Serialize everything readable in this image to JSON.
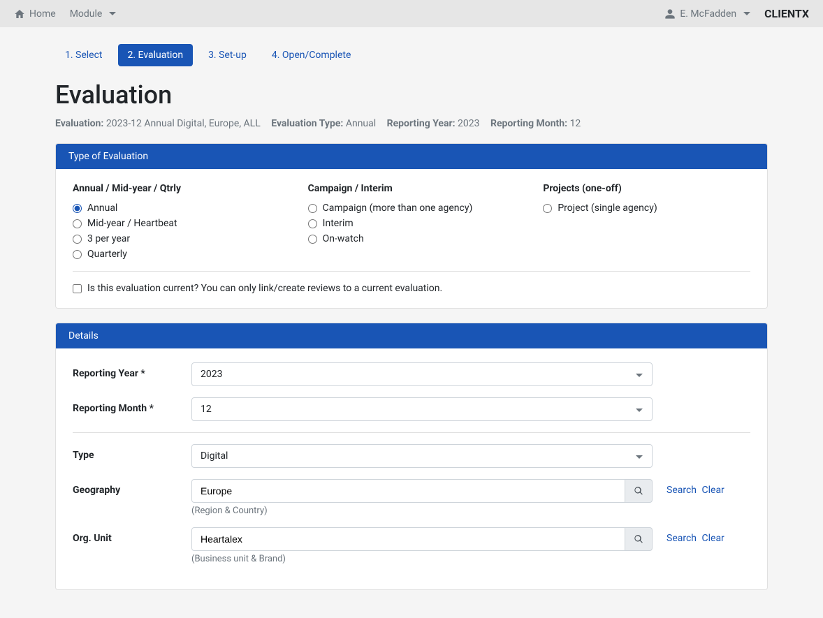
{
  "navbar": {
    "home": "Home",
    "module": "Module",
    "user": "E. McFadden",
    "brand": "CLIENTX"
  },
  "tabs": [
    {
      "label": "1. Select",
      "active": false
    },
    {
      "label": "2. Evaluation",
      "active": true
    },
    {
      "label": "3. Set-up",
      "active": false
    },
    {
      "label": "4. Open/Complete",
      "active": false
    }
  ],
  "page_title": "Evaluation",
  "meta": {
    "evaluation_label": "Evaluation:",
    "evaluation_value": "2023-12 Annual Digital, Europe, ALL",
    "type_label": "Evaluation Type:",
    "type_value": "Annual",
    "year_label": "Reporting Year:",
    "year_value": "2023",
    "month_label": "Reporting Month:",
    "month_value": "12"
  },
  "type_card": {
    "header": "Type of Evaluation",
    "col1": {
      "heading": "Annual / Mid-year / Qtrly",
      "options": [
        "Annual",
        "Mid-year / Heartbeat",
        "3 per year",
        "Quarterly"
      ],
      "selected": "Annual"
    },
    "col2": {
      "heading": "Campaign / Interim",
      "options": [
        "Campaign (more than one agency)",
        "Interim",
        "On-watch"
      ]
    },
    "col3": {
      "heading": "Projects (one-off)",
      "options": [
        "Project (single agency)"
      ]
    },
    "checkbox_label": "Is this evaluation current? You can only link/create reviews to a current evaluation."
  },
  "details_card": {
    "header": "Details",
    "reporting_year": {
      "label": "Reporting Year *",
      "value": "2023"
    },
    "reporting_month": {
      "label": "Reporting Month *",
      "value": "12"
    },
    "type": {
      "label": "Type",
      "value": "Digital"
    },
    "geography": {
      "label": "Geography",
      "value": "Europe",
      "helper": "(Region & Country)"
    },
    "org_unit": {
      "label": "Org. Unit",
      "value": "Heartalex",
      "helper": "(Business unit & Brand)"
    },
    "search_label": "Search",
    "clear_label": "Clear"
  }
}
